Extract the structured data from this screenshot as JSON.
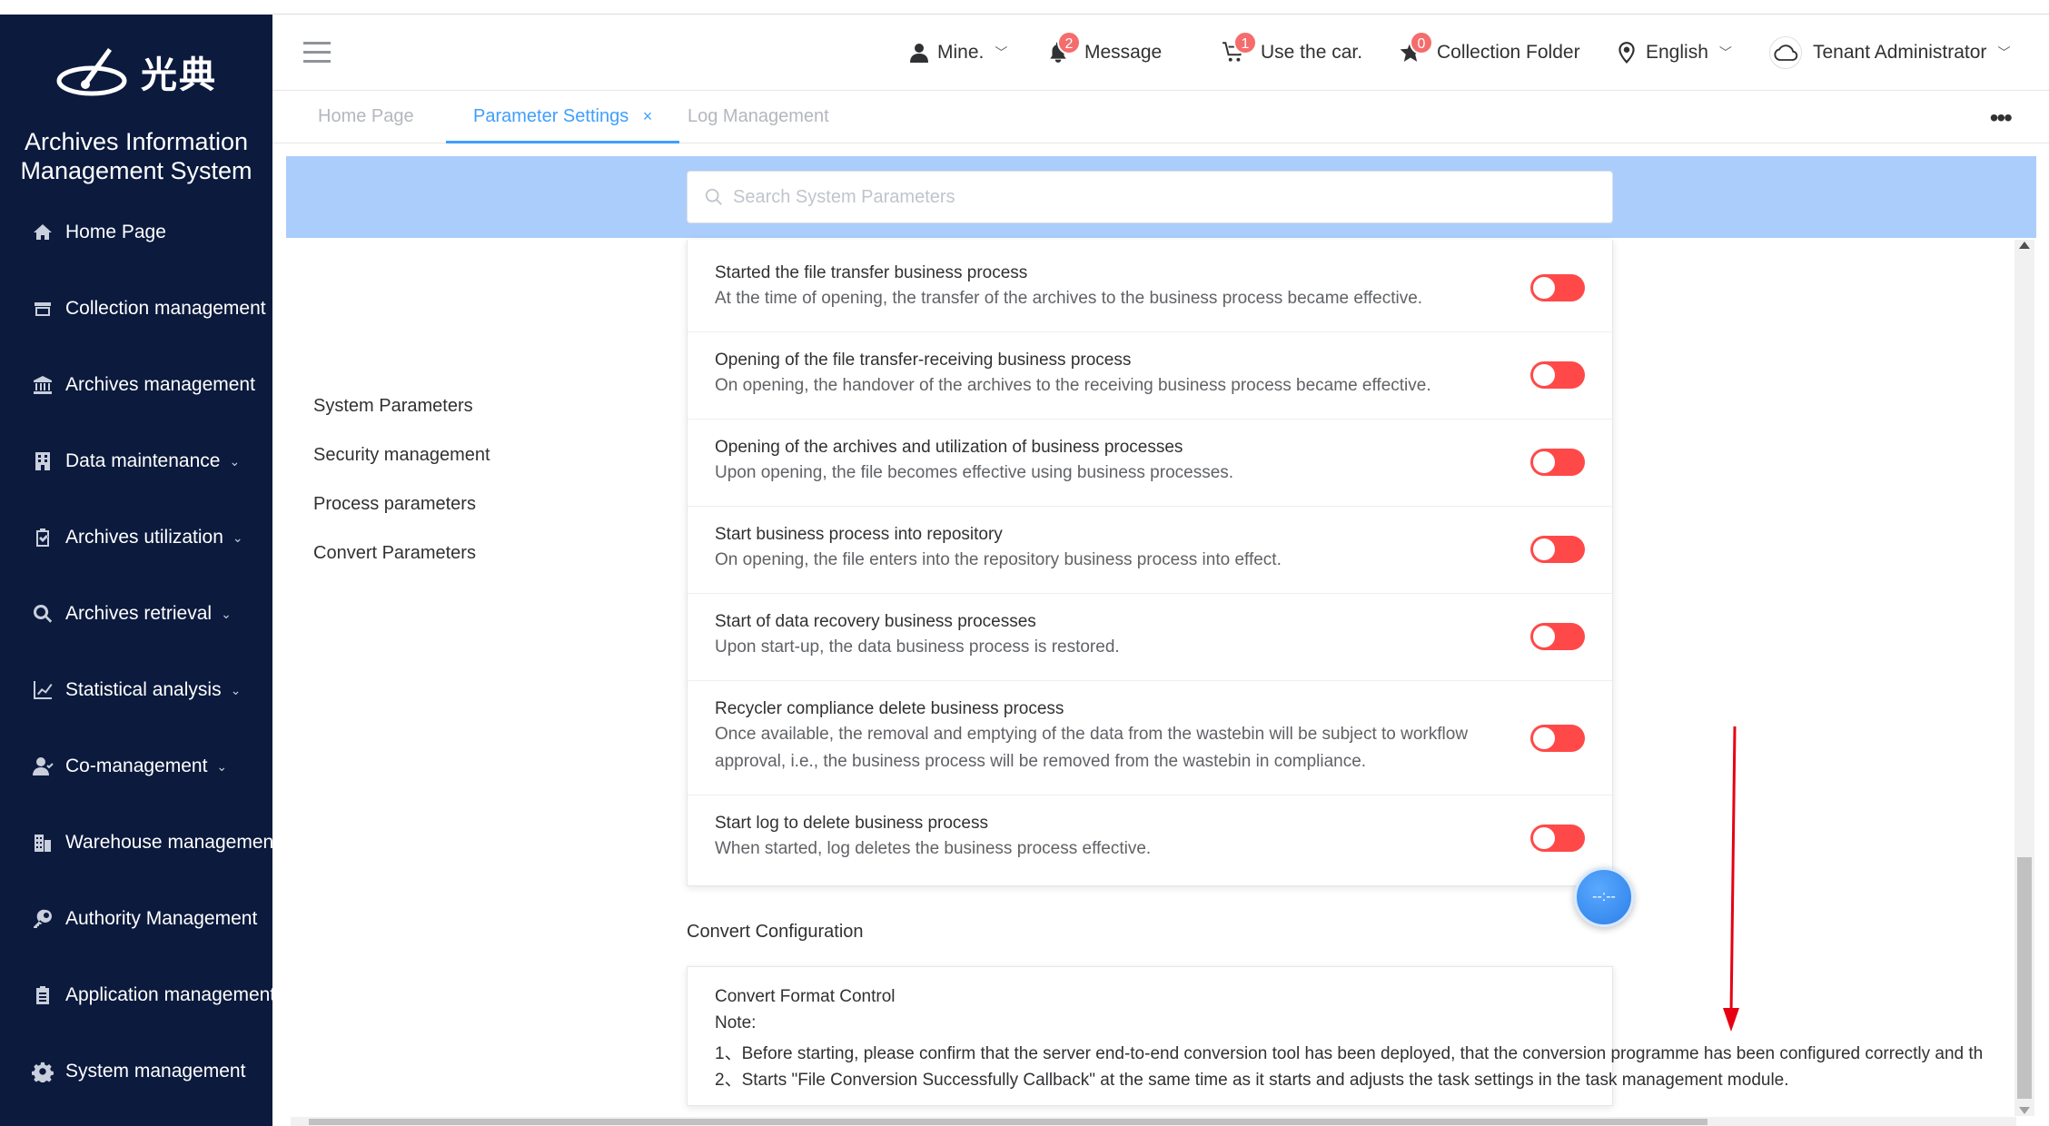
{
  "app": {
    "logo_text": "光典",
    "system_title_line1": "Archives Information",
    "system_title_line2": "Management System"
  },
  "sidebar": {
    "items": [
      {
        "label": "Home Page",
        "icon": "home-icon",
        "chevron": ""
      },
      {
        "label": "Collection management",
        "icon": "box-icon",
        "chevron": "⌄"
      },
      {
        "label": "Archives management",
        "icon": "bank-icon",
        "chevron": "⌄"
      },
      {
        "label": "Data maintenance",
        "icon": "building-icon",
        "chevron": "⌄"
      },
      {
        "label": "Archives utilization",
        "icon": "clipboard-check-icon",
        "chevron": "⌄"
      },
      {
        "label": "Archives retrieval",
        "icon": "search-icon",
        "chevron": "⌄"
      },
      {
        "label": "Statistical analysis",
        "icon": "line-chart-icon",
        "chevron": "⌄"
      },
      {
        "label": "Co-management",
        "icon": "user-group-icon",
        "chevron": "⌄"
      },
      {
        "label": "Warehouse management",
        "icon": "warehouse-icon",
        "chevron": "⌄"
      },
      {
        "label": "Authority Management",
        "icon": "key-icon",
        "chevron": "⌄"
      },
      {
        "label": "Application management",
        "icon": "clipboard-icon",
        "chevron": "⌄"
      },
      {
        "label": "System management",
        "icon": "gear-icon",
        "chevron": "⌄"
      }
    ]
  },
  "header": {
    "mine_label": "Mine.",
    "message_label": "Message",
    "message_count": "2",
    "cart_label": "Use the car.",
    "cart_count": "1",
    "collection_label": "Collection Folder",
    "collection_count": "0",
    "language_label": "English",
    "user_label": "Tenant Administrator"
  },
  "tabs": {
    "items": [
      {
        "label": "Home Page"
      },
      {
        "label": "Parameter Settings"
      },
      {
        "label": "Log Management"
      }
    ],
    "close_glyph": "×",
    "more_glyph": "•••"
  },
  "search": {
    "placeholder": "Search System Parameters"
  },
  "param_menu": {
    "items": [
      {
        "label": "System Parameters"
      },
      {
        "label": "Security management"
      },
      {
        "label": "Process parameters"
      },
      {
        "label": "Convert Parameters"
      }
    ]
  },
  "settings": {
    "rows": [
      {
        "title": "Started the file transfer business process",
        "desc": "At the time of opening, the transfer of the archives to the business process became effective.",
        "enabled": false
      },
      {
        "title": "Opening of the file transfer-receiving business process",
        "desc": "On opening, the handover of the archives to the receiving business process became effective.",
        "enabled": false
      },
      {
        "title": "Opening of the archives and utilization of business processes",
        "desc": "Upon opening, the file becomes effective using business processes.",
        "enabled": false
      },
      {
        "title": "Start business process into repository",
        "desc": "On opening, the file enters into the repository business process into effect.",
        "enabled": false
      },
      {
        "title": "Start of data recovery business processes",
        "desc": "Upon start-up, the data business process is restored.",
        "enabled": false
      },
      {
        "title": "Recycler compliance delete business process",
        "desc": "Once available, the removal and emptying of the data from the wastebin will be subject to workflow approval, i.e., the business process will be removed from the wastebin in compliance.",
        "enabled": false
      },
      {
        "title": "Start log to delete business process",
        "desc": "When started, log deletes the business process effective.",
        "enabled": false
      }
    ]
  },
  "convert": {
    "heading": "Convert Configuration",
    "card_title": "Convert Format Control",
    "note_label": "Note:",
    "note1": "1、Before starting, please confirm that the server end-to-end conversion tool has been deployed, that the conversion programme has been configured correctly and th",
    "note2": "2、Starts \"File Conversion Successfully Callback\" at the same time as it starts and adjusts the task settings in the task management module."
  },
  "float_button": {
    "label": "--:--"
  },
  "colors": {
    "sidebar_bg": "#0b1a3d",
    "accent": "#409eff",
    "toggle_off": "#ff4949",
    "badge": "#f56c6c",
    "band": "#aacdfb"
  }
}
